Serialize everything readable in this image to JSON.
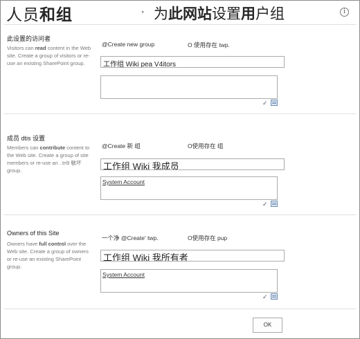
{
  "header": {
    "title_left_pre": "人员",
    "title_left_bold": "和组",
    "title_dot": "▸",
    "title_right_pre": "为",
    "title_right_bold1": "此网站",
    "title_right_mid": "设置",
    "title_right_bold2": "用",
    "title_right_post": "户组",
    "info_icon": "i"
  },
  "visitors": {
    "title": "此设置的访问者",
    "desc_1": "Visitors can ",
    "desc_bold": "read",
    "desc_2": " content in the Web site. Create a group of visitors or re-use an existing SharePoint group.",
    "radio_create": "@Create       new group",
    "radio_existing": "O 使用存在 twp.",
    "group_name": "工作组 Wiki pea V4itors",
    "members_text": ""
  },
  "members": {
    "title": "成员 dtis  设置",
    "desc_1": "Members can ",
    "desc_bold": "contribute",
    "desc_2": " content to the Web site. Create a group of site members or re-use an",
    "desc_3": " ..tri9 敏坏              group.",
    "radio_create": "@Create 新 组",
    "radio_existing": "O使用存在 组",
    "group_name": "工作组  Wiki 我成员",
    "members_text": "System Account"
  },
  "owners": {
    "title": "Owners of this Site",
    "desc_1": "Owners have ",
    "desc_bold": "full control",
    "desc_2": " over the Web site. Create a group of owners or re-use an existing SharePoint group.",
    "radio_create": "一个净 @Create' twp.",
    "radio_existing": "O使用存在   pup",
    "group_name": "工作组  Wiki 我所有者",
    "members_text": "System Account"
  },
  "icons": {
    "check_names": "check-names-icon",
    "browse": "address-book-icon",
    "check_glyph": "✓"
  },
  "footer": {
    "ok_label": "OK"
  }
}
